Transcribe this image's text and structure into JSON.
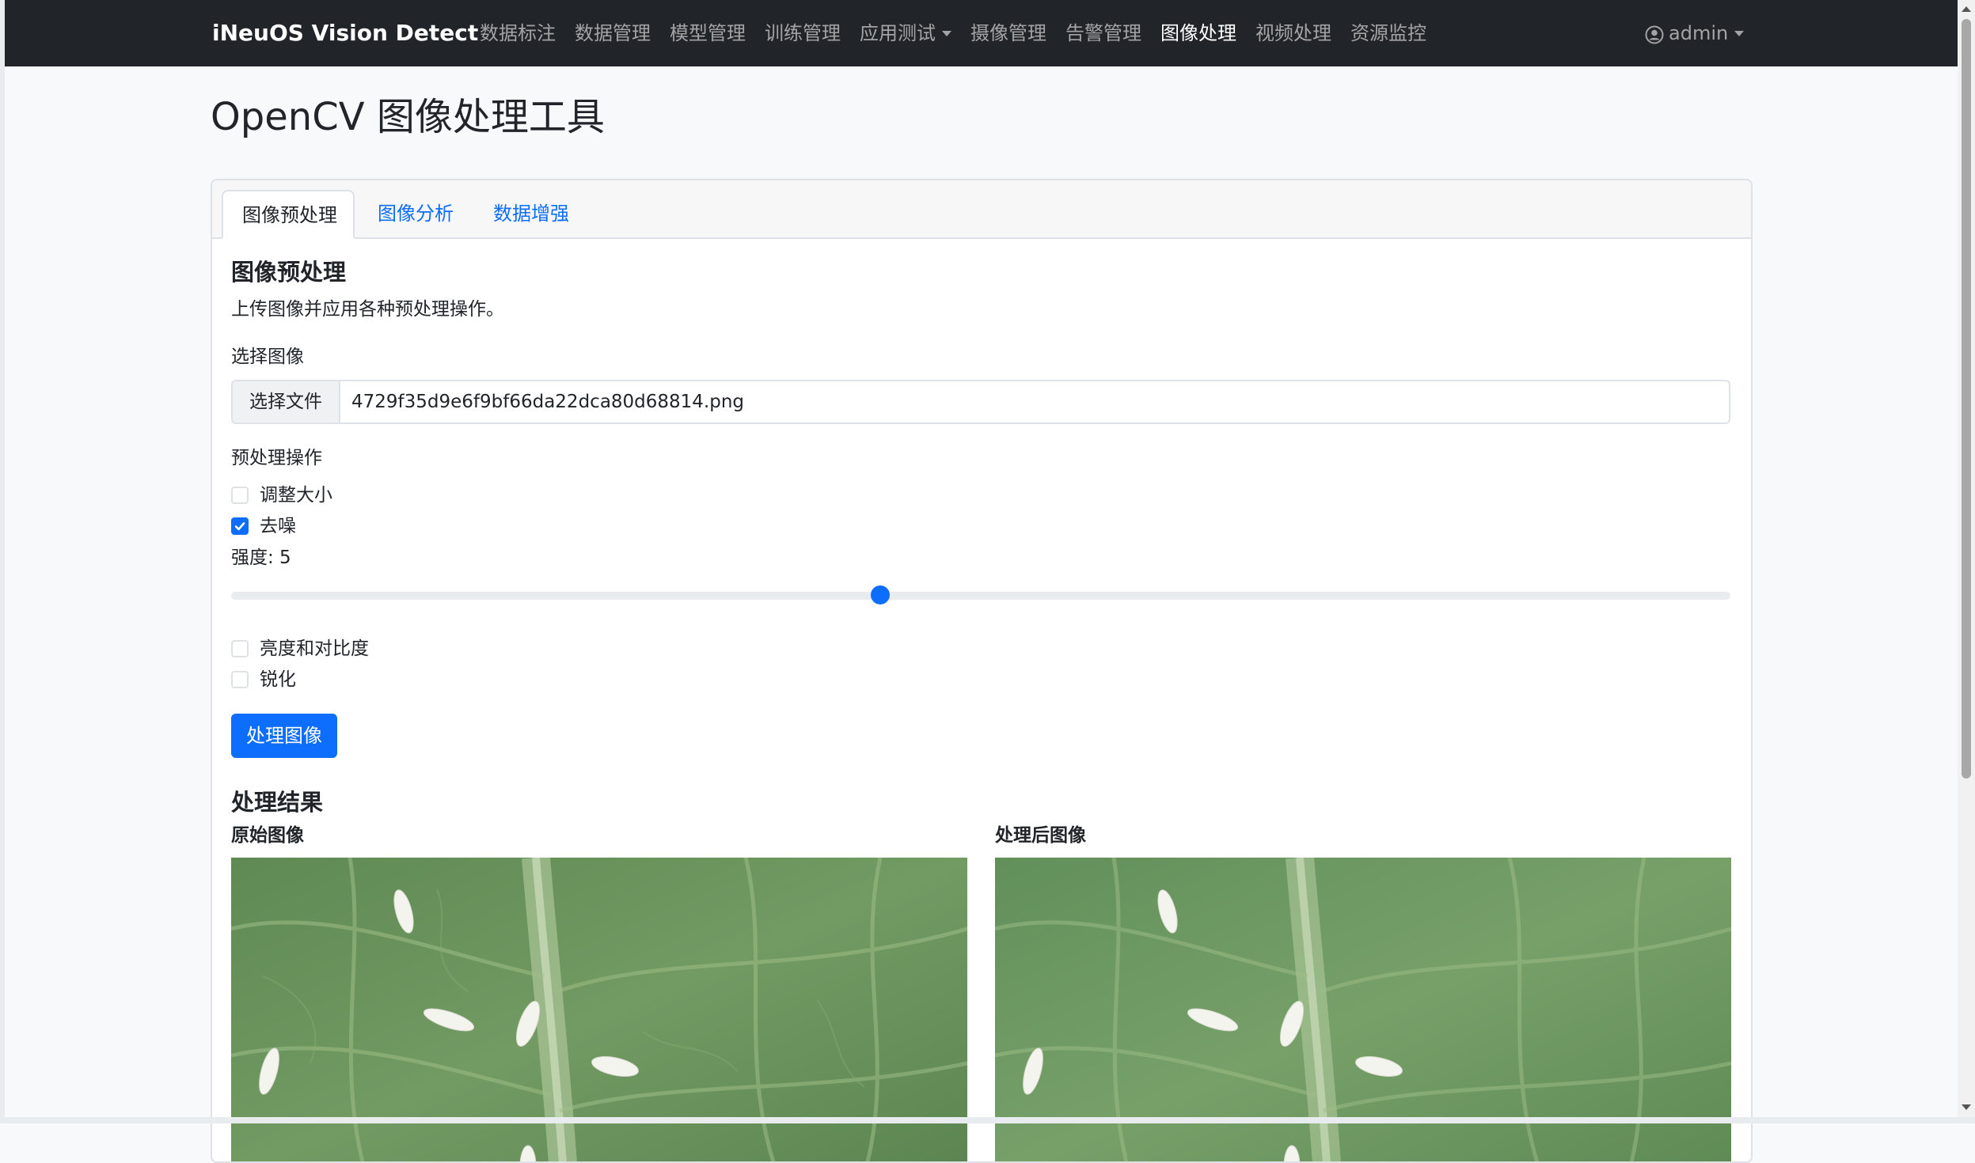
{
  "navbar": {
    "brand": "iNeuOS Vision Detect",
    "links": [
      {
        "label": "数据标注"
      },
      {
        "label": "数据管理"
      },
      {
        "label": "模型管理"
      },
      {
        "label": "训练管理"
      },
      {
        "label": "应用测试"
      },
      {
        "label": "摄像管理"
      },
      {
        "label": "告警管理"
      },
      {
        "label": "图像处理"
      },
      {
        "label": "视频处理"
      },
      {
        "label": "资源监控"
      }
    ],
    "active": "图像处理",
    "user": "admin"
  },
  "page": {
    "title": "OpenCV 图像处理工具"
  },
  "tabs": [
    {
      "label": "图像预处理",
      "active": true
    },
    {
      "label": "图像分析",
      "active": false
    },
    {
      "label": "数据增强",
      "active": false
    }
  ],
  "preprocess": {
    "title": "图像预处理",
    "description": "上传图像并应用各种预处理操作。",
    "file_label": "选择图像",
    "file_button": "选择文件",
    "file_name": "4729f35d9e6f9bf66da22dca80d68814.png",
    "ops_label": "预处理操作",
    "options": {
      "resize": {
        "label": "调整大小",
        "checked": false
      },
      "denoise": {
        "label": "去噪",
        "checked": true
      },
      "brightness": {
        "label": "亮度和对比度",
        "checked": false
      },
      "sharpen": {
        "label": "锐化",
        "checked": false
      }
    },
    "strength_text": "强度: 5",
    "strength_value": 5,
    "strength_fraction": 0.44,
    "process_button": "处理图像"
  },
  "results": {
    "title": "处理结果",
    "original_label": "原始图像",
    "processed_label": "处理后图像"
  },
  "colors": {
    "navbar_bg": "#212529",
    "primary": "#0d6efd",
    "page_bg": "#f8f9fa",
    "leaf": "#6f955f"
  },
  "icons": {
    "user": "user-circle-icon",
    "dropdown": "caret-down-icon"
  }
}
